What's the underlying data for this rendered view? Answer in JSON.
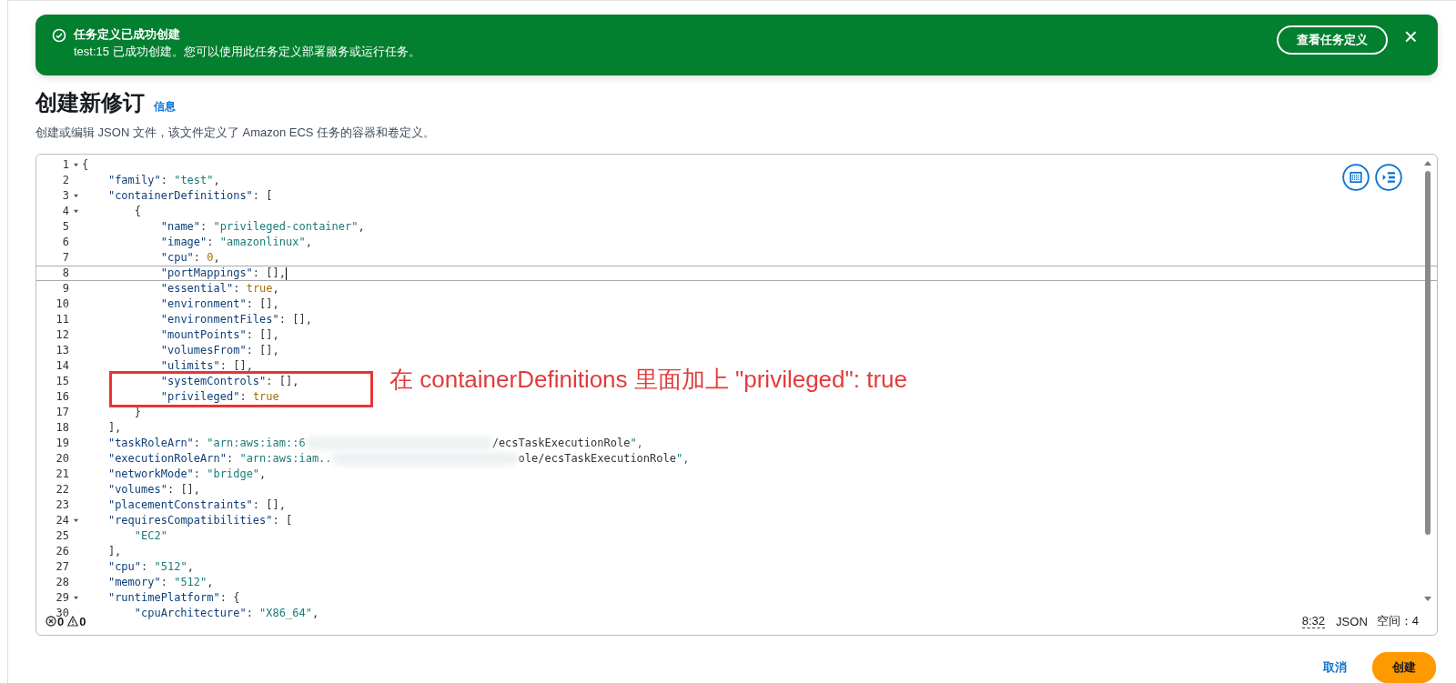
{
  "banner": {
    "kind": "success",
    "title": "任务定义已成功创建",
    "message": "test:15 已成功创建。您可以使用此任务定义部署服务或运行任务。",
    "action": "查看任务定义",
    "close": "×"
  },
  "header": {
    "title": "创建新修订",
    "info_link": "信息",
    "description": "创建或编辑 JSON 文件，该文件定义了 Amazon ECS 任务的容器和卷定义。"
  },
  "editor": {
    "lines": [
      {
        "number": "1",
        "foldable": true,
        "active": false,
        "code": "{"
      },
      {
        "number": "2",
        "foldable": false,
        "active": false,
        "code": "    \"family\": \"test\","
      },
      {
        "number": "3",
        "foldable": true,
        "active": false,
        "code": "    \"containerDefinitions\": ["
      },
      {
        "number": "4",
        "foldable": true,
        "active": false,
        "code": "        {"
      },
      {
        "number": "5",
        "foldable": false,
        "active": false,
        "code": "            \"name\": \"privileged-container\","
      },
      {
        "number": "6",
        "foldable": false,
        "active": false,
        "code": "            \"image\": \"amazonlinux\","
      },
      {
        "number": "7",
        "foldable": false,
        "active": false,
        "code": "            \"cpu\": 0,"
      },
      {
        "number": "8",
        "foldable": false,
        "active": true,
        "code": "            \"portMappings\": [],"
      },
      {
        "number": "9",
        "foldable": false,
        "active": false,
        "code": "            \"essential\": true,"
      },
      {
        "number": "10",
        "foldable": false,
        "active": false,
        "code": "            \"environment\": [],"
      },
      {
        "number": "11",
        "foldable": false,
        "active": false,
        "code": "            \"environmentFiles\": [],"
      },
      {
        "number": "12",
        "foldable": false,
        "active": false,
        "code": "            \"mountPoints\": [],"
      },
      {
        "number": "13",
        "foldable": false,
        "active": false,
        "code": "            \"volumesFrom\": [],"
      },
      {
        "number": "14",
        "foldable": false,
        "active": false,
        "code": "            \"ulimits\": [],"
      },
      {
        "number": "15",
        "foldable": false,
        "active": false,
        "code": "            \"systemControls\": [],"
      },
      {
        "number": "16",
        "foldable": false,
        "active": false,
        "code": "            \"privileged\": true"
      },
      {
        "number": "17",
        "foldable": false,
        "active": false,
        "code": "        }"
      },
      {
        "number": "18",
        "foldable": false,
        "active": false,
        "code": "    ],"
      },
      {
        "number": "19",
        "foldable": false,
        "active": false,
        "code": "    \"taskRoleArn\": \"arn:aws:iam::6",
        "redacted": true,
        "code_after": "/ecsTaskExecutionRole\","
      },
      {
        "number": "20",
        "foldable": false,
        "active": false,
        "code": "    \"executionRoleArn\": \"arn:aws:iam..",
        "redacted": true,
        "code_after": "ole/ecsTaskExecutionRole\","
      },
      {
        "number": "21",
        "foldable": false,
        "active": false,
        "code": "    \"networkMode\": \"bridge\","
      },
      {
        "number": "22",
        "foldable": false,
        "active": false,
        "code": "    \"volumes\": [],"
      },
      {
        "number": "23",
        "foldable": false,
        "active": false,
        "code": "    \"placementConstraints\": [],"
      },
      {
        "number": "24",
        "foldable": true,
        "active": false,
        "code": "    \"requiresCompatibilities\": ["
      },
      {
        "number": "25",
        "foldable": false,
        "active": false,
        "code": "        \"EC2\""
      },
      {
        "number": "26",
        "foldable": false,
        "active": false,
        "code": "    ],"
      },
      {
        "number": "27",
        "foldable": false,
        "active": false,
        "code": "    \"cpu\": \"512\","
      },
      {
        "number": "28",
        "foldable": false,
        "active": false,
        "code": "    \"memory\": \"512\","
      },
      {
        "number": "29",
        "foldable": true,
        "active": false,
        "code": "    \"runtimePlatform\": {"
      },
      {
        "number": "30",
        "foldable": false,
        "active": false,
        "code": "        \"cpuArchitecture\": \"X86_64\","
      }
    ],
    "errors": "0",
    "warnings": "0",
    "cursor": "8:32",
    "language": "JSON",
    "indent": "空间：4"
  },
  "annotation": {
    "text": "在 containerDefinitions 里面加上 \"privileged\": true"
  },
  "actions": {
    "cancel": "取消",
    "submit": "创建"
  }
}
